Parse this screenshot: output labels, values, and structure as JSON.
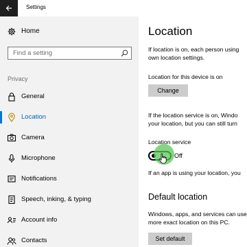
{
  "window": {
    "title": "Settings"
  },
  "sidebar": {
    "home_label": "Home",
    "search_placeholder": "Find a setting",
    "section_label": "Privacy",
    "items": [
      {
        "label": "General",
        "icon": "lock-icon"
      },
      {
        "label": "Location",
        "icon": "location-pin-icon",
        "active": true
      },
      {
        "label": "Camera",
        "icon": "camera-icon"
      },
      {
        "label": "Microphone",
        "icon": "microphone-icon"
      },
      {
        "label": "Notifications",
        "icon": "notifications-icon"
      },
      {
        "label": "Speech, inking, & typing",
        "icon": "speech-icon"
      },
      {
        "label": "Account info",
        "icon": "account-info-icon"
      },
      {
        "label": "Contacts",
        "icon": "contacts-icon"
      }
    ]
  },
  "main": {
    "title": "Location",
    "intro_line1": "If location is on, each person using",
    "intro_line2": "own location settings.",
    "device_status": "Location for this device is on",
    "change_button": "Change",
    "service_line1": "If the location service is on, Windo",
    "service_line2": "your location, but you can still turn",
    "service_label": "Location service",
    "service_toggle": {
      "state": "Off",
      "on": false
    },
    "app_note": "If an app is using your location, you",
    "default_heading": "Default location",
    "default_line1": "Windows, apps, and services can use",
    "default_line2": "more exact location on this PC.",
    "set_default_button": "Set default"
  },
  "colors": {
    "accent": "#0078d7",
    "sidebar_bg": "#f2f2f2",
    "button_bg": "#cccccc",
    "click_highlight": "#58c858"
  }
}
